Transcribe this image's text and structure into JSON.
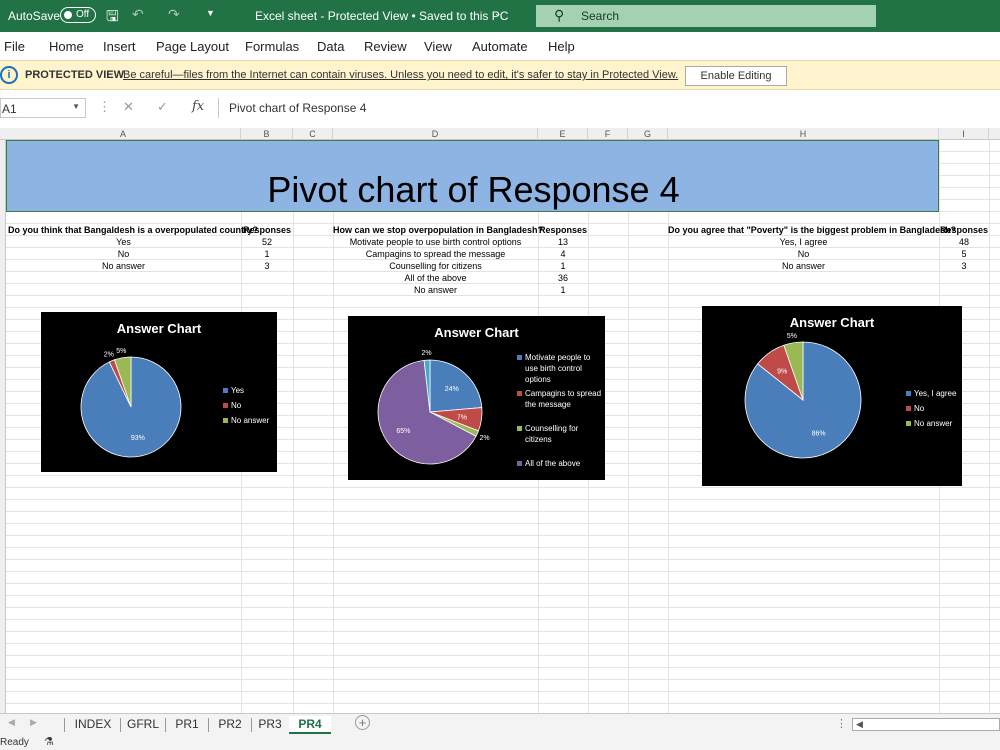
{
  "titlebar": {
    "autosave_label": "AutoSave",
    "autosave_state": "Off",
    "doc_title": "Excel sheet  -  Protected View • Saved to this PC",
    "search_placeholder": "Search"
  },
  "menu": [
    "File",
    "Home",
    "Insert",
    "Page Layout",
    "Formulas",
    "Data",
    "Review",
    "View",
    "Automate",
    "Help"
  ],
  "protected_view": {
    "title": "PROTECTED VIEW",
    "message": "Be careful—files from the Internet can contain viruses. Unless you need to edit, it's safer to stay in Protected View.",
    "button": "Enable Editing"
  },
  "formula_bar": {
    "name_box": "A1",
    "fx": "fx",
    "formula": "Pivot chart of Response 4"
  },
  "columns": [
    "A",
    "B",
    "C",
    "D",
    "E",
    "F",
    "G",
    "H",
    "I"
  ],
  "banner_title": "Pivot chart of Response 4",
  "tables": [
    {
      "question": "Do you think that Bangaldesh is a overpopulated country?",
      "header": "Responses",
      "rows": [
        {
          "label": "Yes",
          "value": "52"
        },
        {
          "label": "No",
          "value": "1"
        },
        {
          "label": "No answer",
          "value": "3"
        }
      ]
    },
    {
      "question": "How can we stop overpopulation in Bangladesh?",
      "header": "Responses",
      "rows": [
        {
          "label": "Motivate people to use birth control options",
          "value": "13"
        },
        {
          "label": "Campagins to spread the message",
          "value": "4"
        },
        {
          "label": "Counselling for citizens",
          "value": "1"
        },
        {
          "label": "All of the above",
          "value": "36"
        },
        {
          "label": "No answer",
          "value": "1"
        }
      ]
    },
    {
      "question": "Do you agree that \"Poverty\" is the biggest problem in Bangladesh?",
      "header": "Responses",
      "rows": [
        {
          "label": "Yes, I agree",
          "value": "48"
        },
        {
          "label": "No",
          "value": "5"
        },
        {
          "label": "No answer",
          "value": "3"
        }
      ]
    }
  ],
  "chart_data": [
    {
      "type": "pie",
      "title": "Answer Chart",
      "categories": [
        "Yes",
        "No",
        "No answer"
      ],
      "values": [
        52,
        1,
        3
      ],
      "labels": [
        "93%",
        "2%",
        "5%"
      ],
      "colors": [
        "#4a7ebb",
        "#be4b48",
        "#98b954"
      ],
      "legend": "right"
    },
    {
      "type": "pie",
      "title": "Answer Chart",
      "categories": [
        "Motivate people to use birth control options",
        "Campagins to spread the message",
        "Counselling for citizens",
        "All of the above",
        "No answer"
      ],
      "values": [
        13,
        4,
        1,
        36,
        1
      ],
      "labels": [
        "24%",
        "7%",
        "2%",
        "65%",
        "2%"
      ],
      "colors": [
        "#4a7ebb",
        "#be4b48",
        "#98b954",
        "#7d5fa0",
        "#46aac5"
      ],
      "legend_lines": [
        [
          "Motivate people to",
          "use birth control",
          "options"
        ],
        [
          "Campagins to spread",
          "the message"
        ],
        [
          "Counselling for",
          "citizens"
        ],
        [
          "All of the above"
        ]
      ],
      "legend": "right"
    },
    {
      "type": "pie",
      "title": "Answer Chart",
      "categories": [
        "Yes, I agree",
        "No",
        "No answer"
      ],
      "values": [
        48,
        5,
        3
      ],
      "labels": [
        "86%",
        "9%",
        "5%"
      ],
      "colors": [
        "#4a7ebb",
        "#be4b48",
        "#98b954"
      ],
      "legend": "right"
    }
  ],
  "sheet_tabs": [
    "INDEX",
    "GFRL",
    "PR1",
    "PR2",
    "PR3",
    "PR4"
  ],
  "active_tab": "PR4",
  "status": "Ready"
}
